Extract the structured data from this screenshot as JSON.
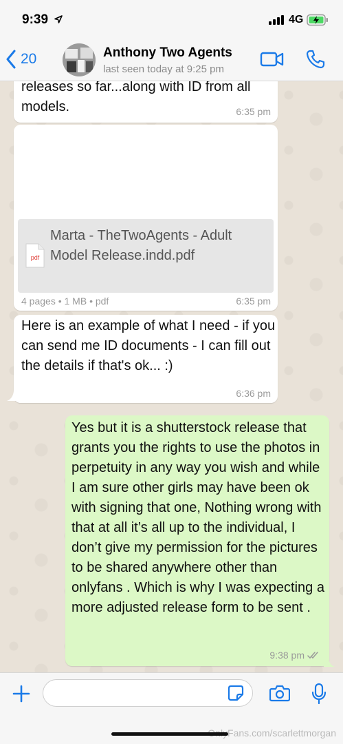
{
  "status_bar": {
    "time": "9:39",
    "network": "4G",
    "icons": [
      "location-arrow-icon",
      "signal-bars-icon",
      "battery-charging-icon"
    ]
  },
  "header": {
    "back_count": "20",
    "contact_name": "Anthony Two Agents",
    "last_seen": "last seen today at 9:25 pm",
    "icons": [
      "chevron-left-icon",
      "video-camera-icon",
      "phone-icon"
    ]
  },
  "messages": [
    {
      "direction": "incoming",
      "text": "releases so far...along with ID from all models.",
      "time": "6:35 pm"
    },
    {
      "direction": "incoming",
      "type": "document",
      "file_name": "Marta - TheTwoAgents - Adult Model Release.indd.pdf",
      "file_icon_label": "pdf",
      "meta": "4 pages • 1 MB • pdf",
      "time": "6:35 pm"
    },
    {
      "direction": "incoming",
      "text": "Here is an example of what I need - if you can send me ID documents - I can fill out the details if that's ok... :)",
      "time": "6:36 pm"
    },
    {
      "direction": "outgoing",
      "text": "Yes but it is a shutterstock release that grants you the rights to use the photos in perpetuity in any way you wish and while I am sure other girls may have been ok with signing that one, Nothing wrong with that at all it’s all up to the individual, I don’t give my permission for the pictures to be shared anywhere other than onlyfans . Which is why I was expecting a more adjusted release form to be sent .",
      "time": "9:38 pm",
      "status": "read"
    }
  ],
  "input_bar": {
    "placeholder": "",
    "icons": [
      "plus-icon",
      "sticker-icon",
      "camera-icon",
      "microphone-icon"
    ]
  },
  "watermark": "OnlyFans.com/scarlettmorgan",
  "colors": {
    "accent": "#1a7ae8",
    "outgoing_bubble": "#dcf8c6",
    "incoming_bubble": "#ffffff",
    "pdf_red": "#e0443e"
  }
}
